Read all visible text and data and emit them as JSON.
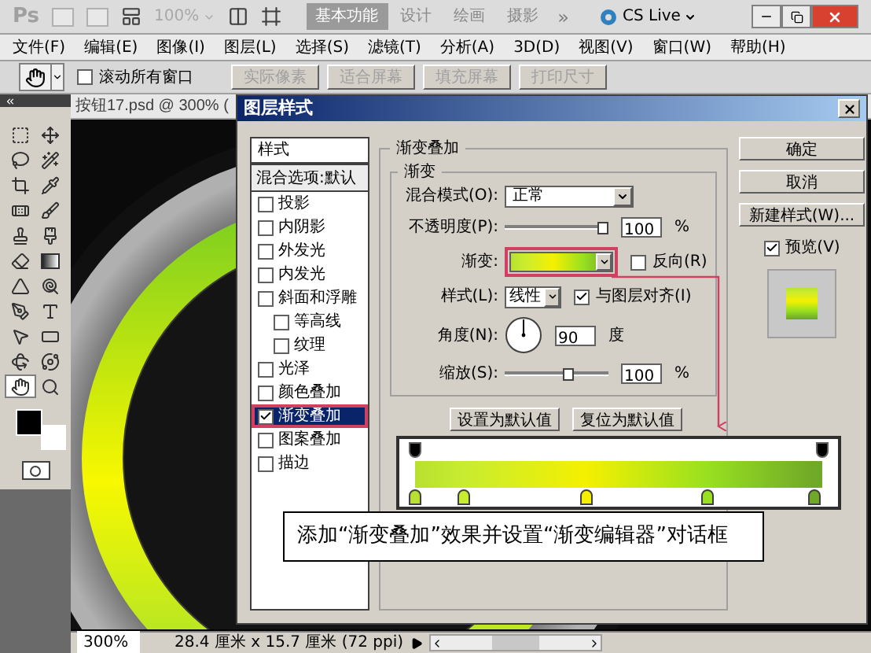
{
  "app_bar": {
    "logo": "Ps",
    "zoom": "100%",
    "workspaces": [
      {
        "label": "基本功能",
        "selected": true
      },
      {
        "label": "设计",
        "selected": false
      },
      {
        "label": "绘画",
        "selected": false
      },
      {
        "label": "摄影",
        "selected": false
      }
    ],
    "more": "»",
    "cs_live": "CS Live"
  },
  "menu": [
    "文件(F)",
    "编辑(E)",
    "图像(I)",
    "图层(L)",
    "选择(S)",
    "滤镜(T)",
    "分析(A)",
    "3D(D)",
    "视图(V)",
    "窗口(W)",
    "帮助(H)"
  ],
  "options_bar": {
    "scroll_all": {
      "label": "滚动所有窗口",
      "checked": false
    },
    "buttons": [
      {
        "label": "实际像素",
        "disabled": true
      },
      {
        "label": "适合屏幕",
        "disabled": true
      },
      {
        "label": "填充屏幕",
        "disabled": true
      },
      {
        "label": "打印尺寸",
        "disabled": true
      }
    ]
  },
  "toolbox": {
    "tools": [
      {
        "selected": false
      },
      {
        "selected": false
      },
      {
        "selected": false
      },
      {
        "selected": false
      },
      {
        "selected": false
      },
      {
        "selected": false
      },
      {
        "selected": false
      },
      {
        "selected": false
      },
      {
        "selected": false
      },
      {
        "selected": false
      },
      {
        "selected": false
      },
      {
        "selected": false
      },
      {
        "selected": false
      },
      {
        "selected": false
      },
      {
        "selected": false
      },
      {
        "selected": false
      },
      {
        "selected": false
      },
      {
        "selected": false
      },
      {
        "selected": false
      },
      {
        "selected": false
      },
      {
        "selected": true
      },
      {
        "selected": false
      }
    ]
  },
  "document": {
    "tab": "按钮17.psd @ 300% ("
  },
  "status_bar": {
    "zoom": "300%",
    "size": "28.4 厘米 x 15.7 厘米 (72 ppi)"
  },
  "dialog": {
    "title": "图层样式",
    "styles_panel": {
      "header": "样式",
      "blend_options": "混合选项:默认",
      "effects": [
        {
          "label": "投影",
          "checked": false,
          "selected": false
        },
        {
          "label": "内阴影",
          "checked": false,
          "selected": false
        },
        {
          "label": "外发光",
          "checked": false,
          "selected": false
        },
        {
          "label": "内发光",
          "checked": false,
          "selected": false
        },
        {
          "label": "斜面和浮雕",
          "checked": false,
          "selected": false,
          "children": [
            {
              "label": "等高线",
              "checked": false,
              "selected": false
            },
            {
              "label": "纹理",
              "checked": false,
              "selected": false
            }
          ]
        },
        {
          "label": "光泽",
          "checked": false,
          "selected": false
        },
        {
          "label": "颜色叠加",
          "checked": false,
          "selected": false
        },
        {
          "label": "渐变叠加",
          "checked": true,
          "selected": true
        },
        {
          "label": "图案叠加",
          "checked": false,
          "selected": false
        },
        {
          "label": "描边",
          "checked": false,
          "selected": false
        }
      ]
    },
    "gradient_overlay": {
      "group_title": "渐变叠加",
      "sub_title": "渐变",
      "blend_mode": {
        "label": "混合模式(O):",
        "value": "正常"
      },
      "opacity": {
        "label": "不透明度(P):",
        "level": 1,
        "value": "100",
        "unit": "%"
      },
      "gradient": {
        "label": "渐变:"
      },
      "reverse": {
        "label": "反向(R)",
        "checked": false
      },
      "style": {
        "label": "样式(L):",
        "value": "线性"
      },
      "align": {
        "label": "与图层对齐(I)",
        "checked": true
      },
      "angle": {
        "label": "角度(N):",
        "value": "90",
        "unit": "度"
      },
      "scale": {
        "label": "缩放(S):",
        "level": 0.63,
        "value": "100",
        "unit": "%"
      },
      "buttons": [
        "设置为默认值",
        "复位为默认值"
      ]
    },
    "actions": {
      "buttons": [
        "确定",
        "取消",
        "新建样式(W)..."
      ],
      "preview": {
        "label": "预览(V)",
        "checked": true
      }
    }
  },
  "gradient_editor": {
    "color_stops": [
      {
        "color": "#b8e030"
      },
      {
        "color": "#c8ec30"
      },
      {
        "color": "#f4f000"
      },
      {
        "color": "#98e020"
      },
      {
        "color": "#70a828"
      }
    ]
  },
  "callout": "添加“渐变叠加”效果并设置“渐变编辑器”对话框"
}
